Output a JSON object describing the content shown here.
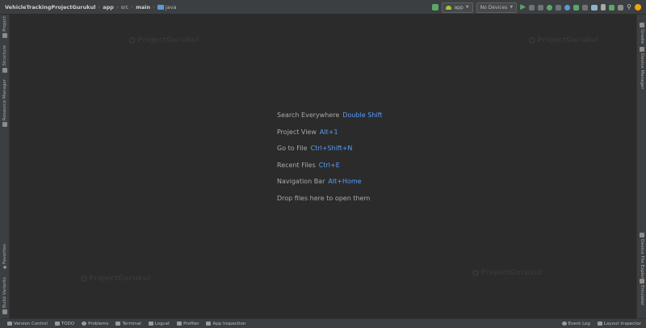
{
  "breadcrumb": {
    "project": "VehicleTrackingProjectGurukul",
    "module": "app",
    "src": "src",
    "main": "main",
    "java": "java"
  },
  "toolbar": {
    "config": "app",
    "device": "No Devices"
  },
  "left_tabs": [
    "Project",
    "Structure",
    "Resource Manager",
    "Favorites",
    "Build Variants"
  ],
  "right_tabs": [
    "Gradle",
    "Device Manager",
    "Device File Explorer",
    "Emulator"
  ],
  "hints": [
    {
      "text": "Search Everywhere",
      "key": "Double Shift"
    },
    {
      "text": "Project View",
      "key": "Alt+1"
    },
    {
      "text": "Go to File",
      "key": "Ctrl+Shift+N"
    },
    {
      "text": "Recent Files",
      "key": "Ctrl+E"
    },
    {
      "text": "Navigation Bar",
      "key": "Alt+Home"
    },
    {
      "text": "Drop files here to open them",
      "key": ""
    }
  ],
  "watermark": "ProjectGurukul",
  "status_left": [
    "Version Control",
    "TODO",
    "Problems",
    "Terminal",
    "Logcat",
    "Profiler",
    "App Inspection"
  ],
  "status_right": [
    "Event Log",
    "Layout Inspector"
  ],
  "colors": {
    "accent_key": "#589df6",
    "run_green": "#59a869",
    "folder_blue": "#5a9bd5"
  }
}
